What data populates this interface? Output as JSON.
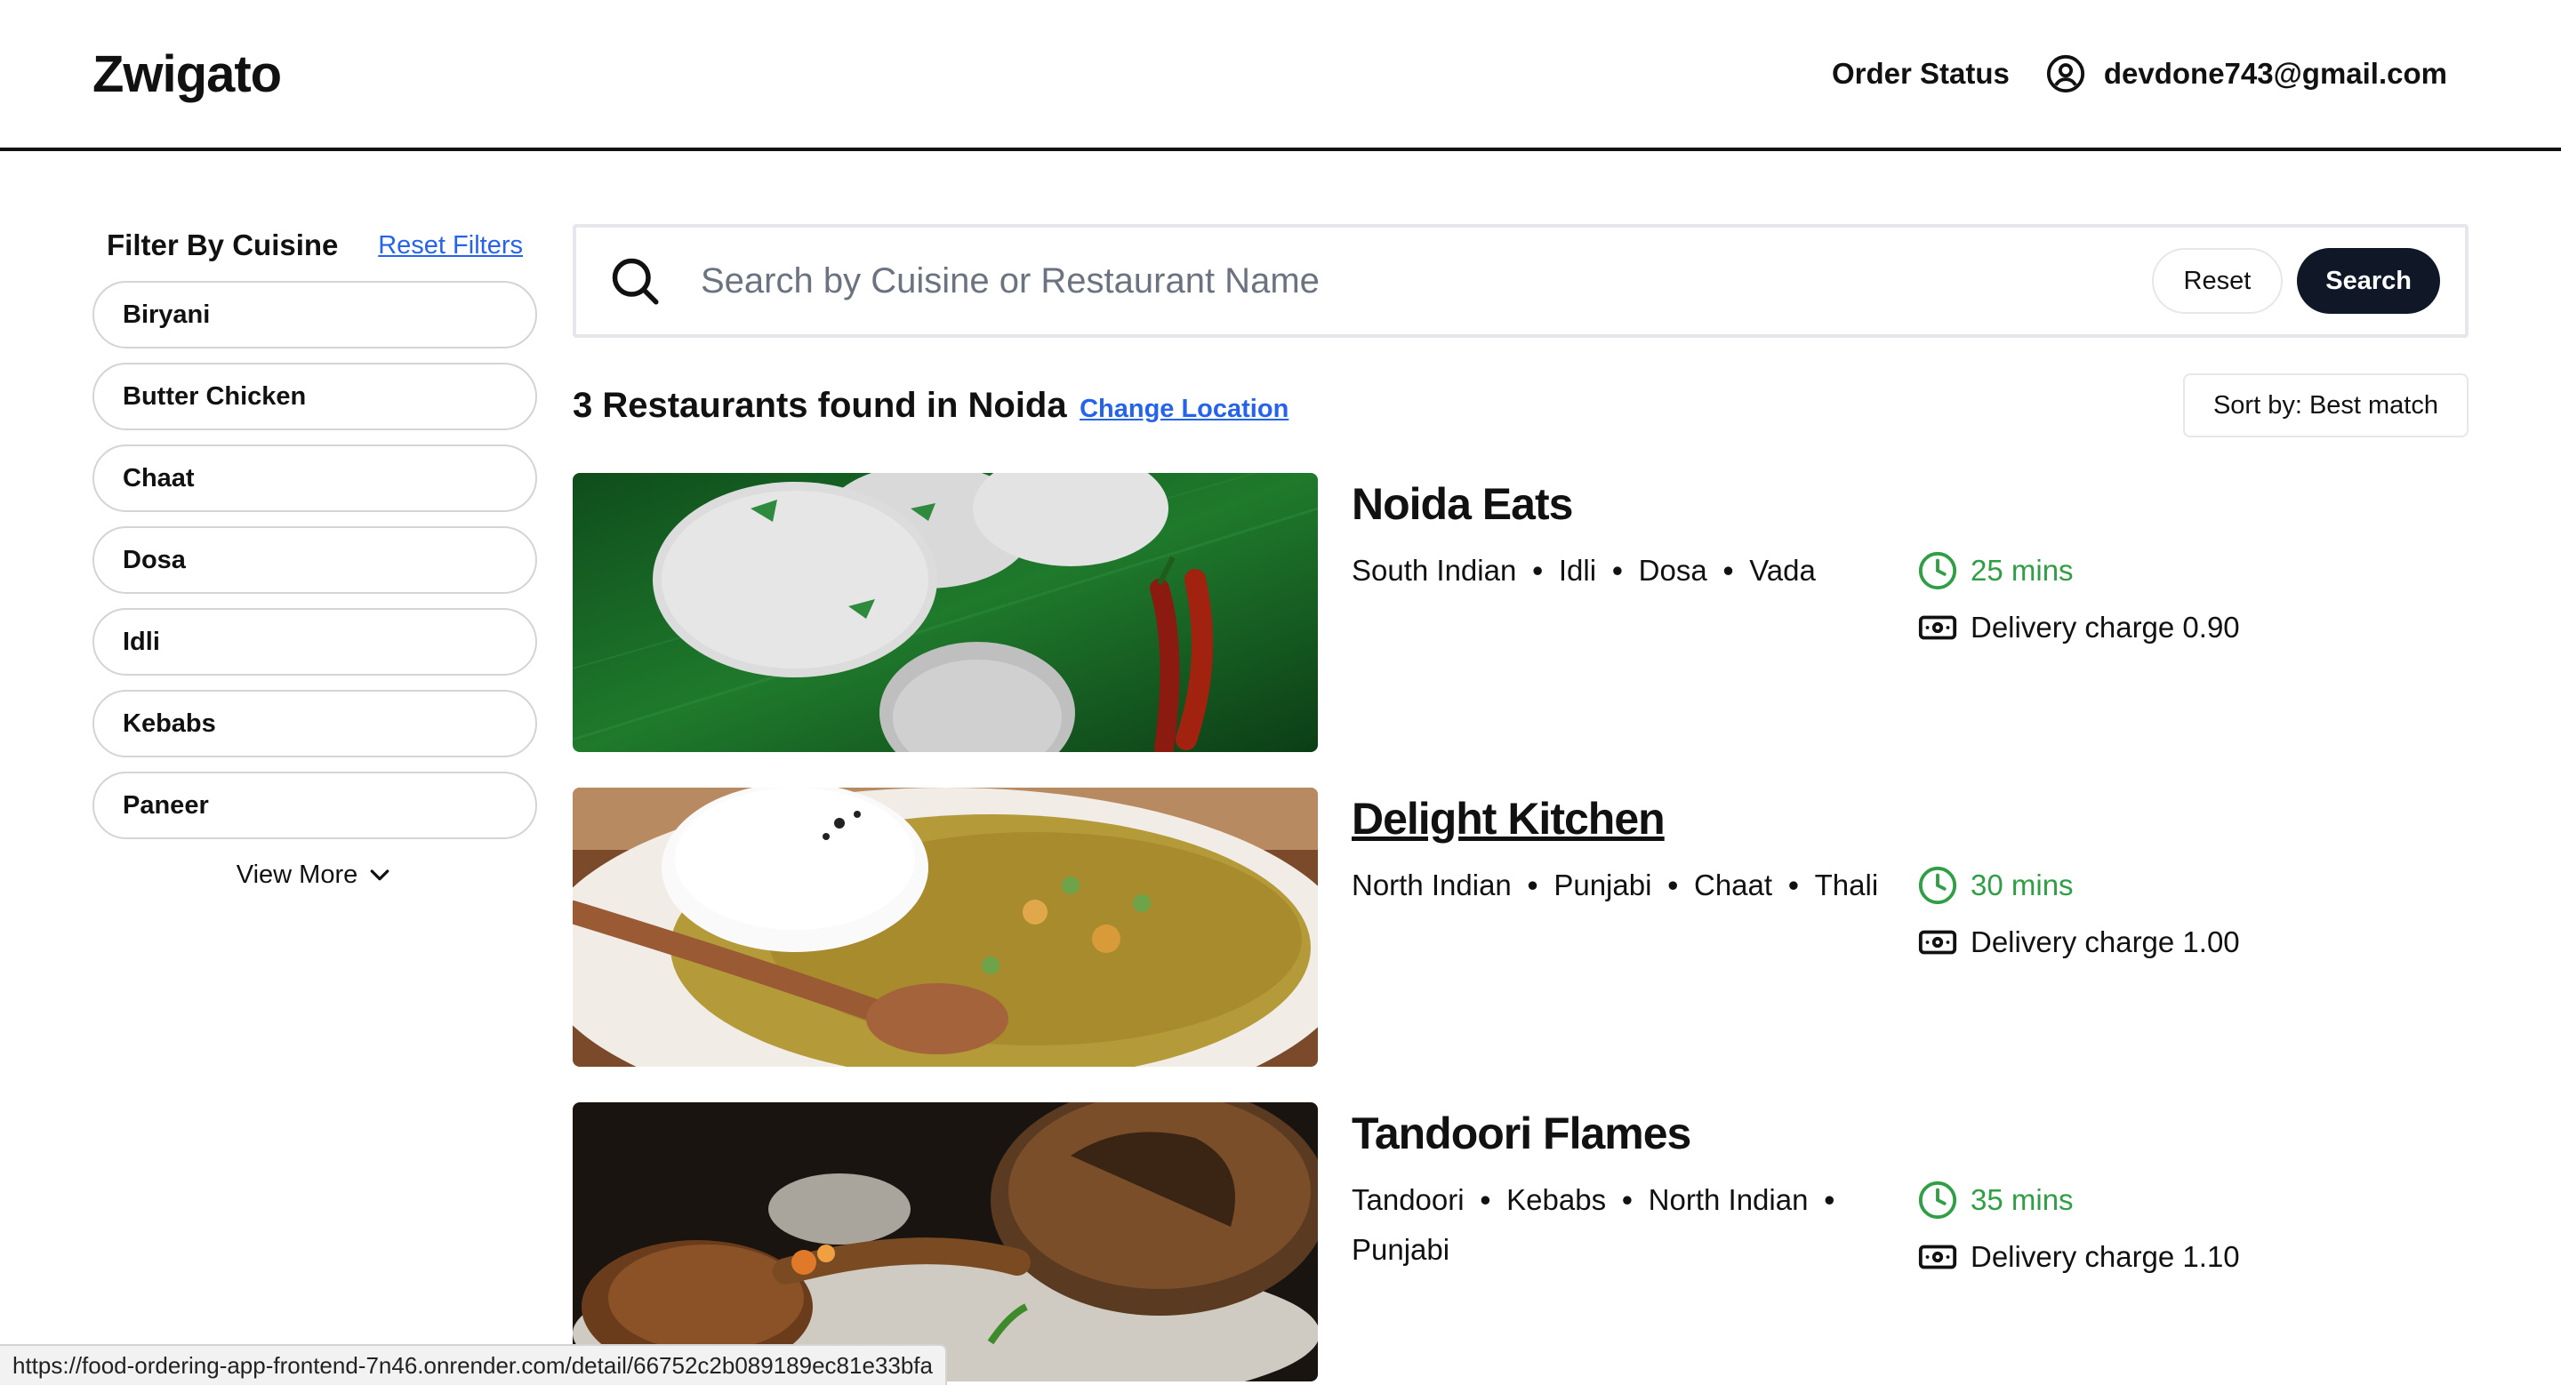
{
  "header": {
    "logo": "Zwigato",
    "order_status": "Order Status",
    "user_email": "devdone743@gmail.com"
  },
  "sidebar": {
    "title": "Filter By Cuisine",
    "reset_filters": "Reset Filters",
    "cuisines": [
      "Biryani",
      "Butter Chicken",
      "Chaat",
      "Dosa",
      "Idli",
      "Kebabs",
      "Paneer"
    ],
    "view_more": "View More"
  },
  "search": {
    "placeholder": "Search by Cuisine or Restaurant Name",
    "value": "",
    "reset_label": "Reset",
    "search_label": "Search"
  },
  "results": {
    "text": "3 Restaurants found in Noida",
    "change_location": "Change Location",
    "sort_label": "Sort by: Best match"
  },
  "restaurants": [
    {
      "name": "Noida Eats",
      "cuisines": [
        "South Indian",
        "Idli",
        "Dosa",
        "Vada"
      ],
      "eta": "25 mins",
      "delivery": "Delivery charge 0.90"
    },
    {
      "name": "Delight Kitchen",
      "cuisines": [
        "North Indian",
        "Punjabi",
        "Chaat",
        "Thali"
      ],
      "eta": "30 mins",
      "delivery": "Delivery charge 1.00"
    },
    {
      "name": "Tandoori Flames",
      "cuisines": [
        "Tandoori",
        "Kebabs",
        "North Indian",
        "Punjabi"
      ],
      "eta": "35 mins",
      "delivery": "Delivery charge 1.10"
    }
  ],
  "status_bar": {
    "url": "https://food-ordering-app-frontend-7n46.onrender.com/detail/66752c2b089189ec81e33bfa"
  },
  "colors": {
    "accent_link": "#2563eb",
    "eta_green": "#2f9e44",
    "search_button_bg": "#101828"
  }
}
